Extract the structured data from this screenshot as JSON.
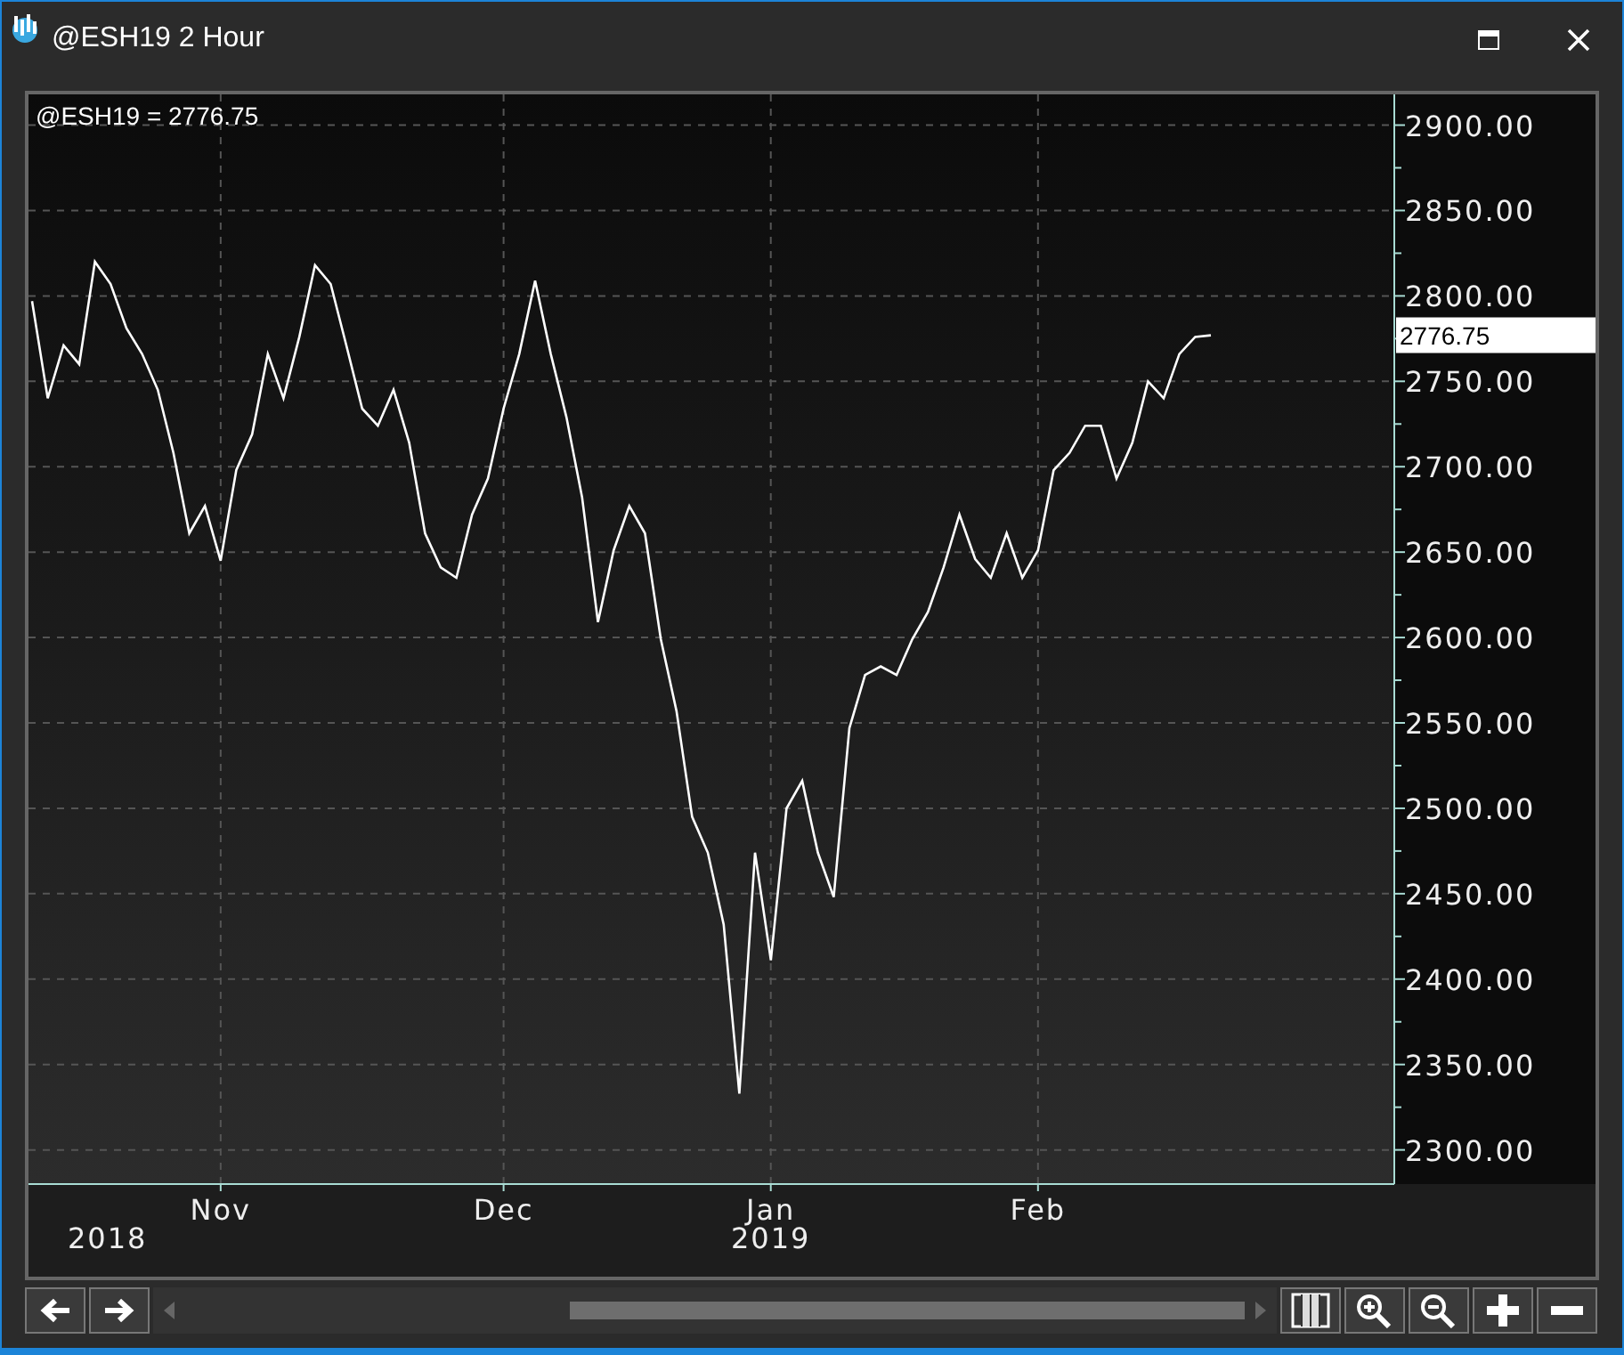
{
  "window": {
    "title": "@ESH19 2 Hour"
  },
  "chart": {
    "legend": "@ESH19 = 2776.75",
    "period_labels": [
      {
        "text": "2018"
      },
      {
        "text": "2019"
      }
    ],
    "chart_data": {
      "type": "line",
      "grid": true,
      "categories": [
        null,
        null,
        null,
        null,
        null,
        null,
        null,
        null,
        null,
        null,
        null,
        null,
        "Nov",
        null,
        null,
        null,
        null,
        null,
        null,
        null,
        null,
        null,
        null,
        null,
        null,
        null,
        null,
        null,
        null,
        null,
        "Dec",
        null,
        null,
        null,
        null,
        null,
        null,
        null,
        null,
        null,
        null,
        null,
        null,
        null,
        null,
        null,
        null,
        "Jan",
        null,
        null,
        null,
        null,
        null,
        null,
        null,
        null,
        null,
        null,
        null,
        null,
        null,
        null,
        null,
        null,
        "Feb",
        null,
        null,
        null,
        null,
        null,
        null,
        null,
        null,
        null,
        null,
        null
      ],
      "series": [
        {
          "color": "#ffffff",
          "values": [
            2797,
            2740,
            2771,
            2760,
            2820,
            2807,
            2781,
            2766,
            2745,
            2708,
            2661,
            2677,
            2645,
            2698,
            2719,
            2766,
            2740,
            2776,
            2818,
            2807,
            2771,
            2734,
            2724,
            2745,
            2714,
            2661,
            2641,
            2635,
            2672,
            2693,
            2734,
            2766,
            2809,
            2766,
            2729,
            2682,
            2609,
            2651,
            2677,
            2661,
            2599,
            2557,
            2495,
            2474,
            2432,
            2333,
            2474,
            2411,
            2500,
            2516,
            2474,
            2448,
            2547,
            2578,
            2583,
            2578,
            2599,
            2615,
            2641,
            2672,
            2646,
            2635,
            2661,
            2635,
            2651,
            2698,
            2708,
            2724,
            2724,
            2693,
            2714,
            2750,
            2740,
            2766,
            2776,
            2777
          ]
        }
      ],
      "ylim": [
        2280,
        2918
      ],
      "yticks": [
        {
          "value": 2300,
          "label": "2300.00"
        },
        {
          "value": 2350,
          "label": "2350.00"
        },
        {
          "value": 2400,
          "label": "2400.00"
        },
        {
          "value": 2450,
          "label": "2450.00"
        },
        {
          "value": 2500,
          "label": "2500.00"
        },
        {
          "value": 2550,
          "label": "2550.00"
        },
        {
          "value": 2600,
          "label": "2600.00"
        },
        {
          "value": 2650,
          "label": "2650.00"
        },
        {
          "value": 2700,
          "label": "2700.00"
        },
        {
          "value": 2750,
          "label": "2750.00"
        },
        {
          "value": 2800,
          "label": "2800.00"
        },
        {
          "value": 2850,
          "label": "2850.00"
        },
        {
          "value": 2900,
          "label": "2900.00"
        }
      ],
      "annotations": [
        "2776.75"
      ]
    }
  }
}
